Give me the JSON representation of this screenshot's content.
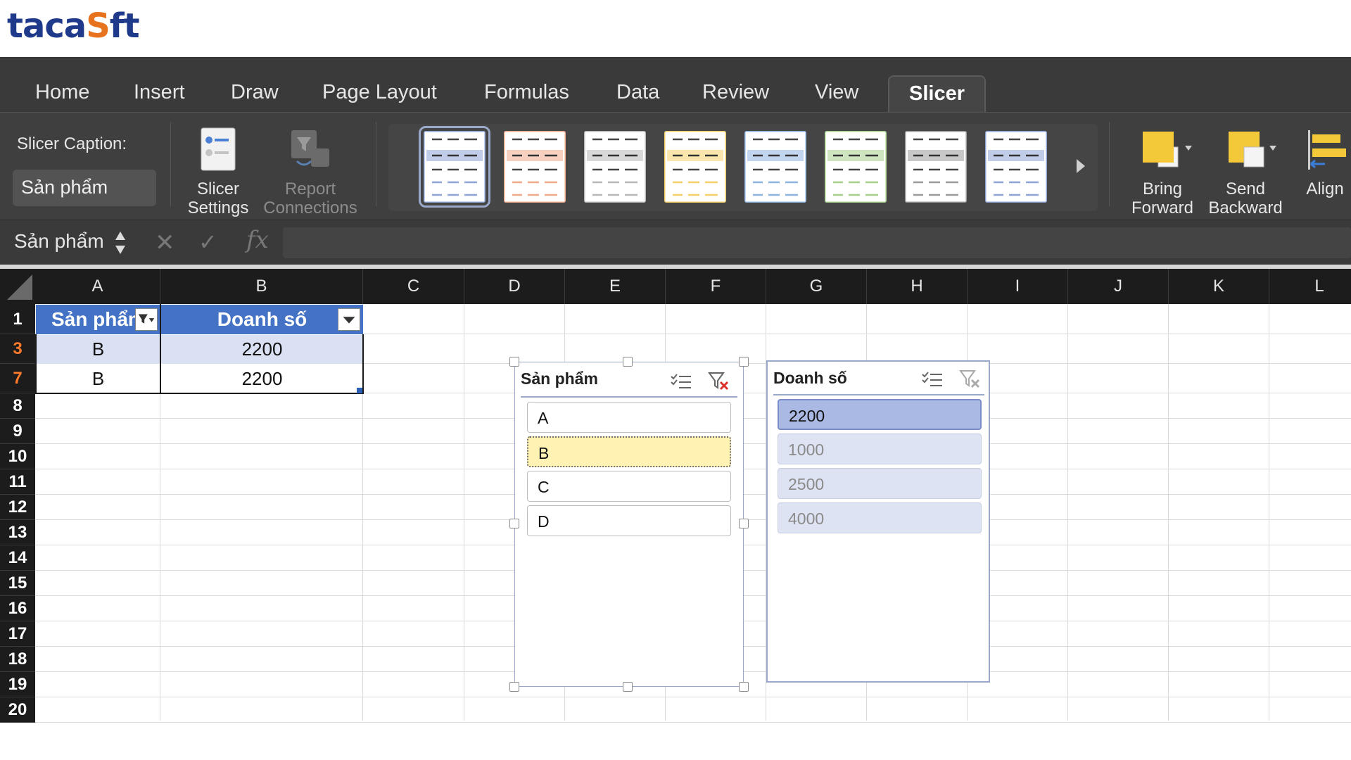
{
  "logo": {
    "part1": "taca",
    "part2": "S",
    "part3": "ft"
  },
  "ribbon": {
    "tabs": [
      "Home",
      "Insert",
      "Draw",
      "Page Layout",
      "Formulas",
      "Data",
      "Review",
      "View",
      "Slicer"
    ],
    "active_tab": "Slicer",
    "caption_label": "Slicer Caption:",
    "caption_value": "Sản phẩm",
    "slicer_settings": [
      "Slicer",
      "Settings"
    ],
    "report_connections": [
      "Report",
      "Connections"
    ],
    "bring_forward": [
      "Bring",
      "Forward"
    ],
    "send_backward": [
      "Send",
      "Backward"
    ],
    "align": "Align",
    "style_colors": [
      "#8ea3d6",
      "#f0a98b",
      "#b8b8b8",
      "#f5cf6a",
      "#8fb3e0",
      "#a8d08d",
      "#9a9a9a",
      "#8ea3d6"
    ]
  },
  "formula_bar": {
    "name_box": "Sản phẩm",
    "fx": "fx"
  },
  "grid": {
    "columns": [
      "A",
      "B",
      "C",
      "D",
      "E",
      "F",
      "G",
      "H",
      "I",
      "J",
      "K",
      "L"
    ],
    "rows": [
      "1",
      "3",
      "7",
      "8",
      "9",
      "10",
      "11",
      "12",
      "13",
      "14",
      "15",
      "16",
      "17",
      "18",
      "19",
      "20"
    ],
    "filtered_rows": [
      "3",
      "7"
    ],
    "table": {
      "headers": [
        "Sản phẩm",
        "Doanh số"
      ],
      "rows": [
        [
          "B",
          "2200"
        ],
        [
          "B",
          "2200"
        ]
      ]
    }
  },
  "slicers": [
    {
      "title": "Sản phẩm",
      "items": [
        {
          "label": "A",
          "state": "normal"
        },
        {
          "label": "B",
          "state": "selected"
        },
        {
          "label": "C",
          "state": "normal"
        },
        {
          "label": "D",
          "state": "normal"
        }
      ]
    },
    {
      "title": "Doanh số",
      "items": [
        {
          "label": "2200",
          "state": "selected"
        },
        {
          "label": "1000",
          "state": "dim"
        },
        {
          "label": "2500",
          "state": "dim"
        },
        {
          "label": "4000",
          "state": "dim"
        }
      ]
    }
  ]
}
